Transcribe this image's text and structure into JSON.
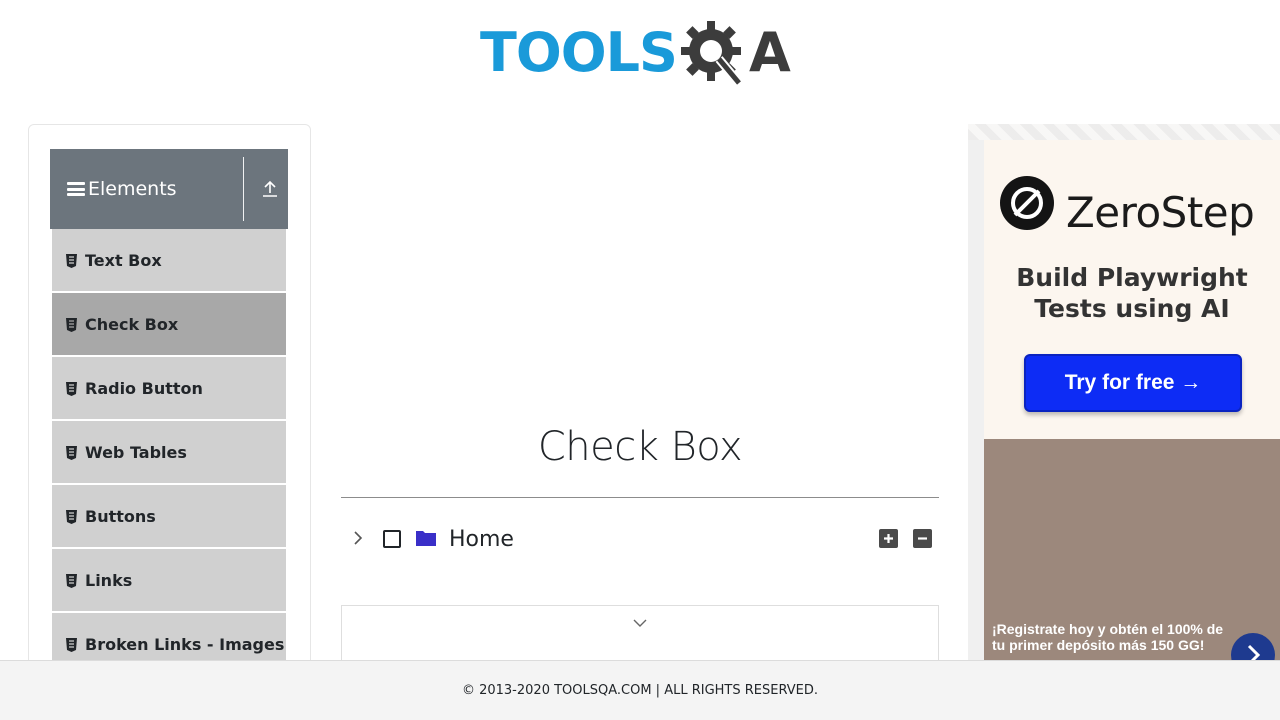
{
  "header": {
    "logo_text_left": "TOOLS",
    "logo_text_right": "A",
    "logo_icon": "gear-magnifier-icon",
    "brand_colors": {
      "tools": "#1a9ad9",
      "qa": "#3c3c3c"
    }
  },
  "sidebar": {
    "group_title": "Elements",
    "group_icon": "hamburger-icon",
    "collapse_icon": "upload-arrow-icon",
    "items": [
      {
        "label": "Text Box",
        "icon": "html5-icon",
        "active": false
      },
      {
        "label": "Check Box",
        "icon": "html5-icon",
        "active": true
      },
      {
        "label": "Radio Button",
        "icon": "html5-icon",
        "active": false
      },
      {
        "label": "Web Tables",
        "icon": "html5-icon",
        "active": false
      },
      {
        "label": "Buttons",
        "icon": "html5-icon",
        "active": false
      },
      {
        "label": "Links",
        "icon": "html5-icon",
        "active": false
      },
      {
        "label": "Broken Links - Images",
        "icon": "html5-icon",
        "active": false
      }
    ]
  },
  "main": {
    "title": "Check Box",
    "tree": {
      "root_label": "Home",
      "expand_all_icon": "plus-square-icon",
      "collapse_all_icon": "minus-square-icon",
      "checked": false,
      "expanded": false
    }
  },
  "ad": {
    "brand": "ZeroStep",
    "tagline_line1": "Build Playwright",
    "tagline_line2": "Tests using AI",
    "cta": "Try for free →",
    "promo_line1": "¡Registrate hoy y obtén el 100% de",
    "promo_line2": "tu primer depósito más 150 GG!",
    "colors": {
      "cta": "#0d2cf5",
      "bottom": "#9c887c"
    }
  },
  "footer": {
    "text": "© 2013-2020 TOOLSQA.COM | ALL RIGHTS RESERVED."
  }
}
